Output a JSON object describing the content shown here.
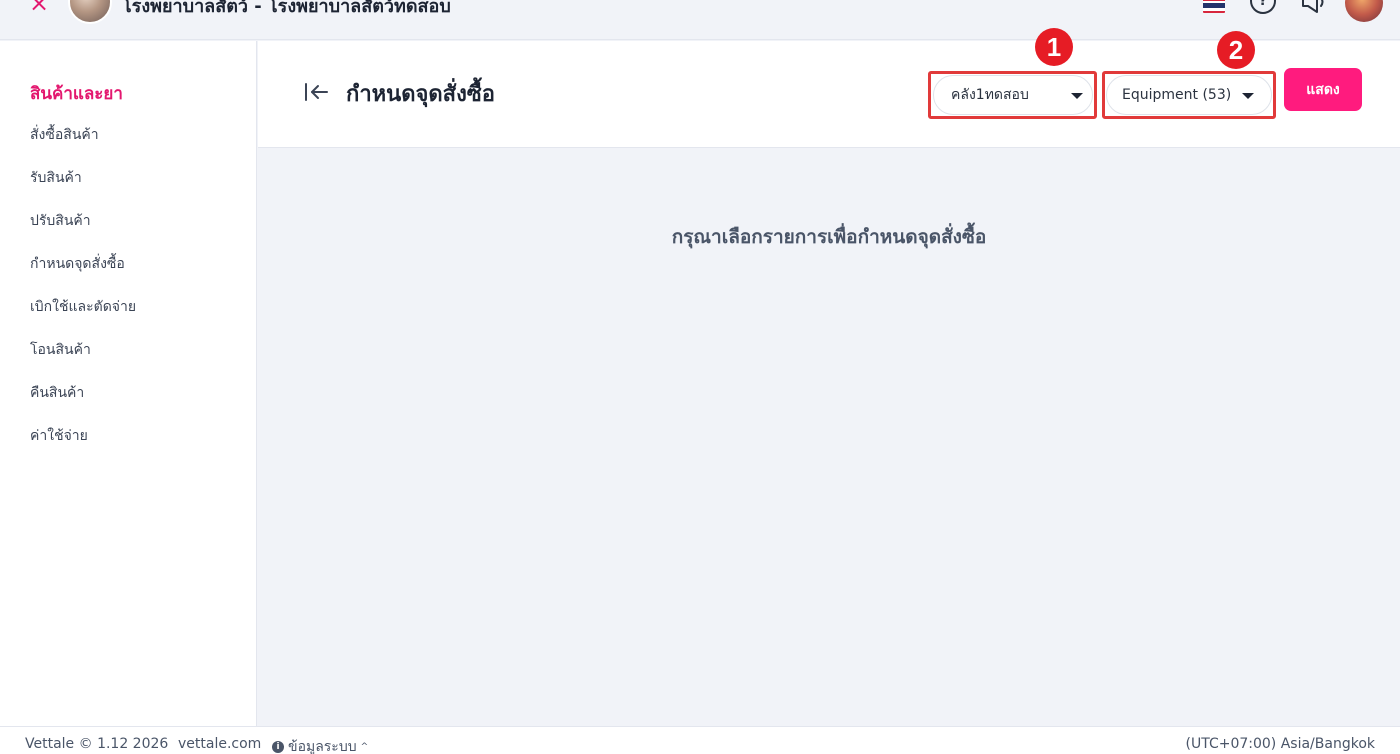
{
  "topbar": {
    "close_icon": "×",
    "clinic_title": "โรงพยาบาลสัตว์ - โรงพยาบาลสัตว์ทดสอบ",
    "help_icon": "?"
  },
  "sidebar": {
    "heading": "สินค้าและยา",
    "items": [
      {
        "label": "สั่งซื้อสินค้า"
      },
      {
        "label": "รับสินค้า"
      },
      {
        "label": "ปรับสินค้า"
      },
      {
        "label": "กำหนดจุดสั่งซื้อ"
      },
      {
        "label": "เบิกใช้และตัดจ่าย"
      },
      {
        "label": "โอนสินค้า"
      },
      {
        "label": "คืนสินค้า"
      },
      {
        "label": "ค่าใช้จ่าย"
      }
    ]
  },
  "main": {
    "title": "กำหนดจุดสั่งซื้อ",
    "warehouse_select": {
      "value": "คลัง1ทดสอบ"
    },
    "category_select": {
      "value": "Equipment (53)"
    },
    "show_button": "แสดง",
    "empty_message": "กรุณาเลือกรายการเพื่อกำหนดจุดสั่งซื้อ",
    "step_badges": [
      "1",
      "2"
    ]
  },
  "footer": {
    "copyright": "Vettale © 1.12 2026",
    "link": "vettale.com",
    "info_icon": "i",
    "system_info": "ข้อมูลระบบ",
    "chevron_icon": "^",
    "timezone": "(UTC+07:00) Asia/Bangkok"
  },
  "colors": {
    "accent": "#ff1b7e",
    "heading_pink": "#e3176f",
    "highlight_red": "#e13a3a",
    "badge_red": "#e61c25"
  }
}
